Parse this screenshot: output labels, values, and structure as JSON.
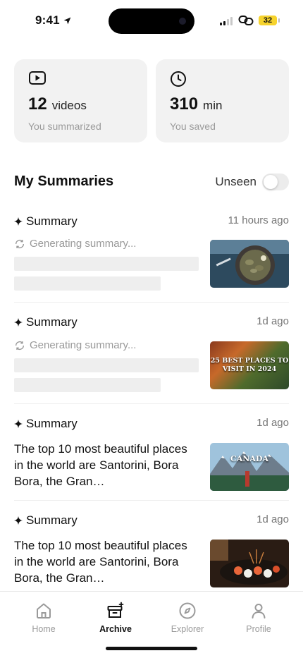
{
  "status_bar": {
    "time": "9:41",
    "battery": "32"
  },
  "stats": [
    {
      "icon": "video-icon",
      "value": "12",
      "unit": "videos",
      "caption": "You summarized"
    },
    {
      "icon": "clock-icon",
      "value": "310",
      "unit": "min",
      "caption": "You saved"
    }
  ],
  "section": {
    "title": "My Summaries",
    "toggle_label": "Unseen",
    "toggle_on": false
  },
  "summaries": [
    {
      "label": "Summary",
      "time": "11 hours ago",
      "status": "Generating summary...",
      "thumb": "seafood dish"
    },
    {
      "label": "Summary",
      "time": "1d ago",
      "status": "Generating summary...",
      "thumb_text": "25 BEST PLACES TO VISIT IN 2024"
    },
    {
      "label": "Summary",
      "time": "1d ago",
      "text": "The top 10 most beautiful places in the world are Santorini, Bora Bora, the Gran…",
      "thumb_text": "CANADA"
    },
    {
      "label": "Summary",
      "time": "1d ago",
      "text": "The top 10 most beautiful places in the world are Santorini, Bora Bora, the Gran…",
      "thumb": "sushi platter"
    }
  ],
  "tabs": [
    {
      "label": "Home",
      "icon": "home-icon",
      "active": false
    },
    {
      "label": "Archive",
      "icon": "archive-icon",
      "active": true
    },
    {
      "label": "Explorer",
      "icon": "compass-icon",
      "active": false
    },
    {
      "label": "Profile",
      "icon": "person-icon",
      "active": false
    }
  ],
  "colors": {
    "card_bg": "#f2f2f2",
    "skeleton": "#eeeeee",
    "muted": "#9a9a9a",
    "battery": "#f6d32d"
  }
}
